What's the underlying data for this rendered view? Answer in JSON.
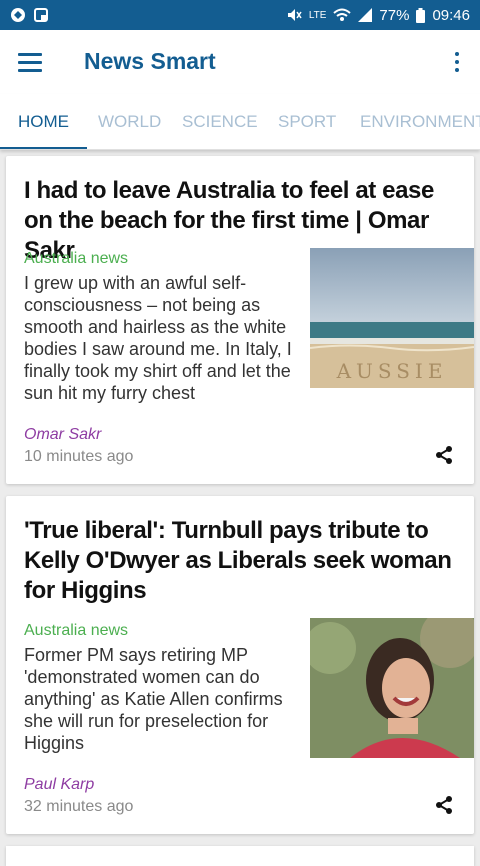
{
  "status": {
    "battery": "77%",
    "time": "09:46",
    "network": "LTE"
  },
  "app": {
    "title": "News Smart"
  },
  "tabs": [
    {
      "label": "HOME",
      "active": true
    },
    {
      "label": "WORLD",
      "active": false
    },
    {
      "label": "SCIENCE",
      "active": false
    },
    {
      "label": "SPORT",
      "active": false
    },
    {
      "label": "ENVIRONMENT",
      "active": false
    }
  ],
  "articles": [
    {
      "headline": "I had to leave Australia to feel at ease on the beach for the first time | Omar Sakr",
      "section": "Australia news",
      "summary": "I grew up with an awful self-consciousness – not being as smooth and hairless as the white bodies I saw around me. In Italy, I finally took my shirt off and let the sun hit my furry chest",
      "author": "Omar Sakr",
      "time": "10 minutes ago",
      "image_text": "AUSSIE"
    },
    {
      "headline": "'True liberal': Turnbull pays tribute to Kelly O'Dwyer as Liberals seek woman for Higgins",
      "section": "Australia news",
      "summary": "Former PM says retiring MP 'demonstrated women can do anything' as Katie Allen confirms she will run for preselection for Higgins",
      "author": "Paul Karp",
      "time": "32 minutes ago"
    }
  ],
  "colors": {
    "brand": "#135d91",
    "section": "#4caf50",
    "author": "#8e3ca2"
  }
}
